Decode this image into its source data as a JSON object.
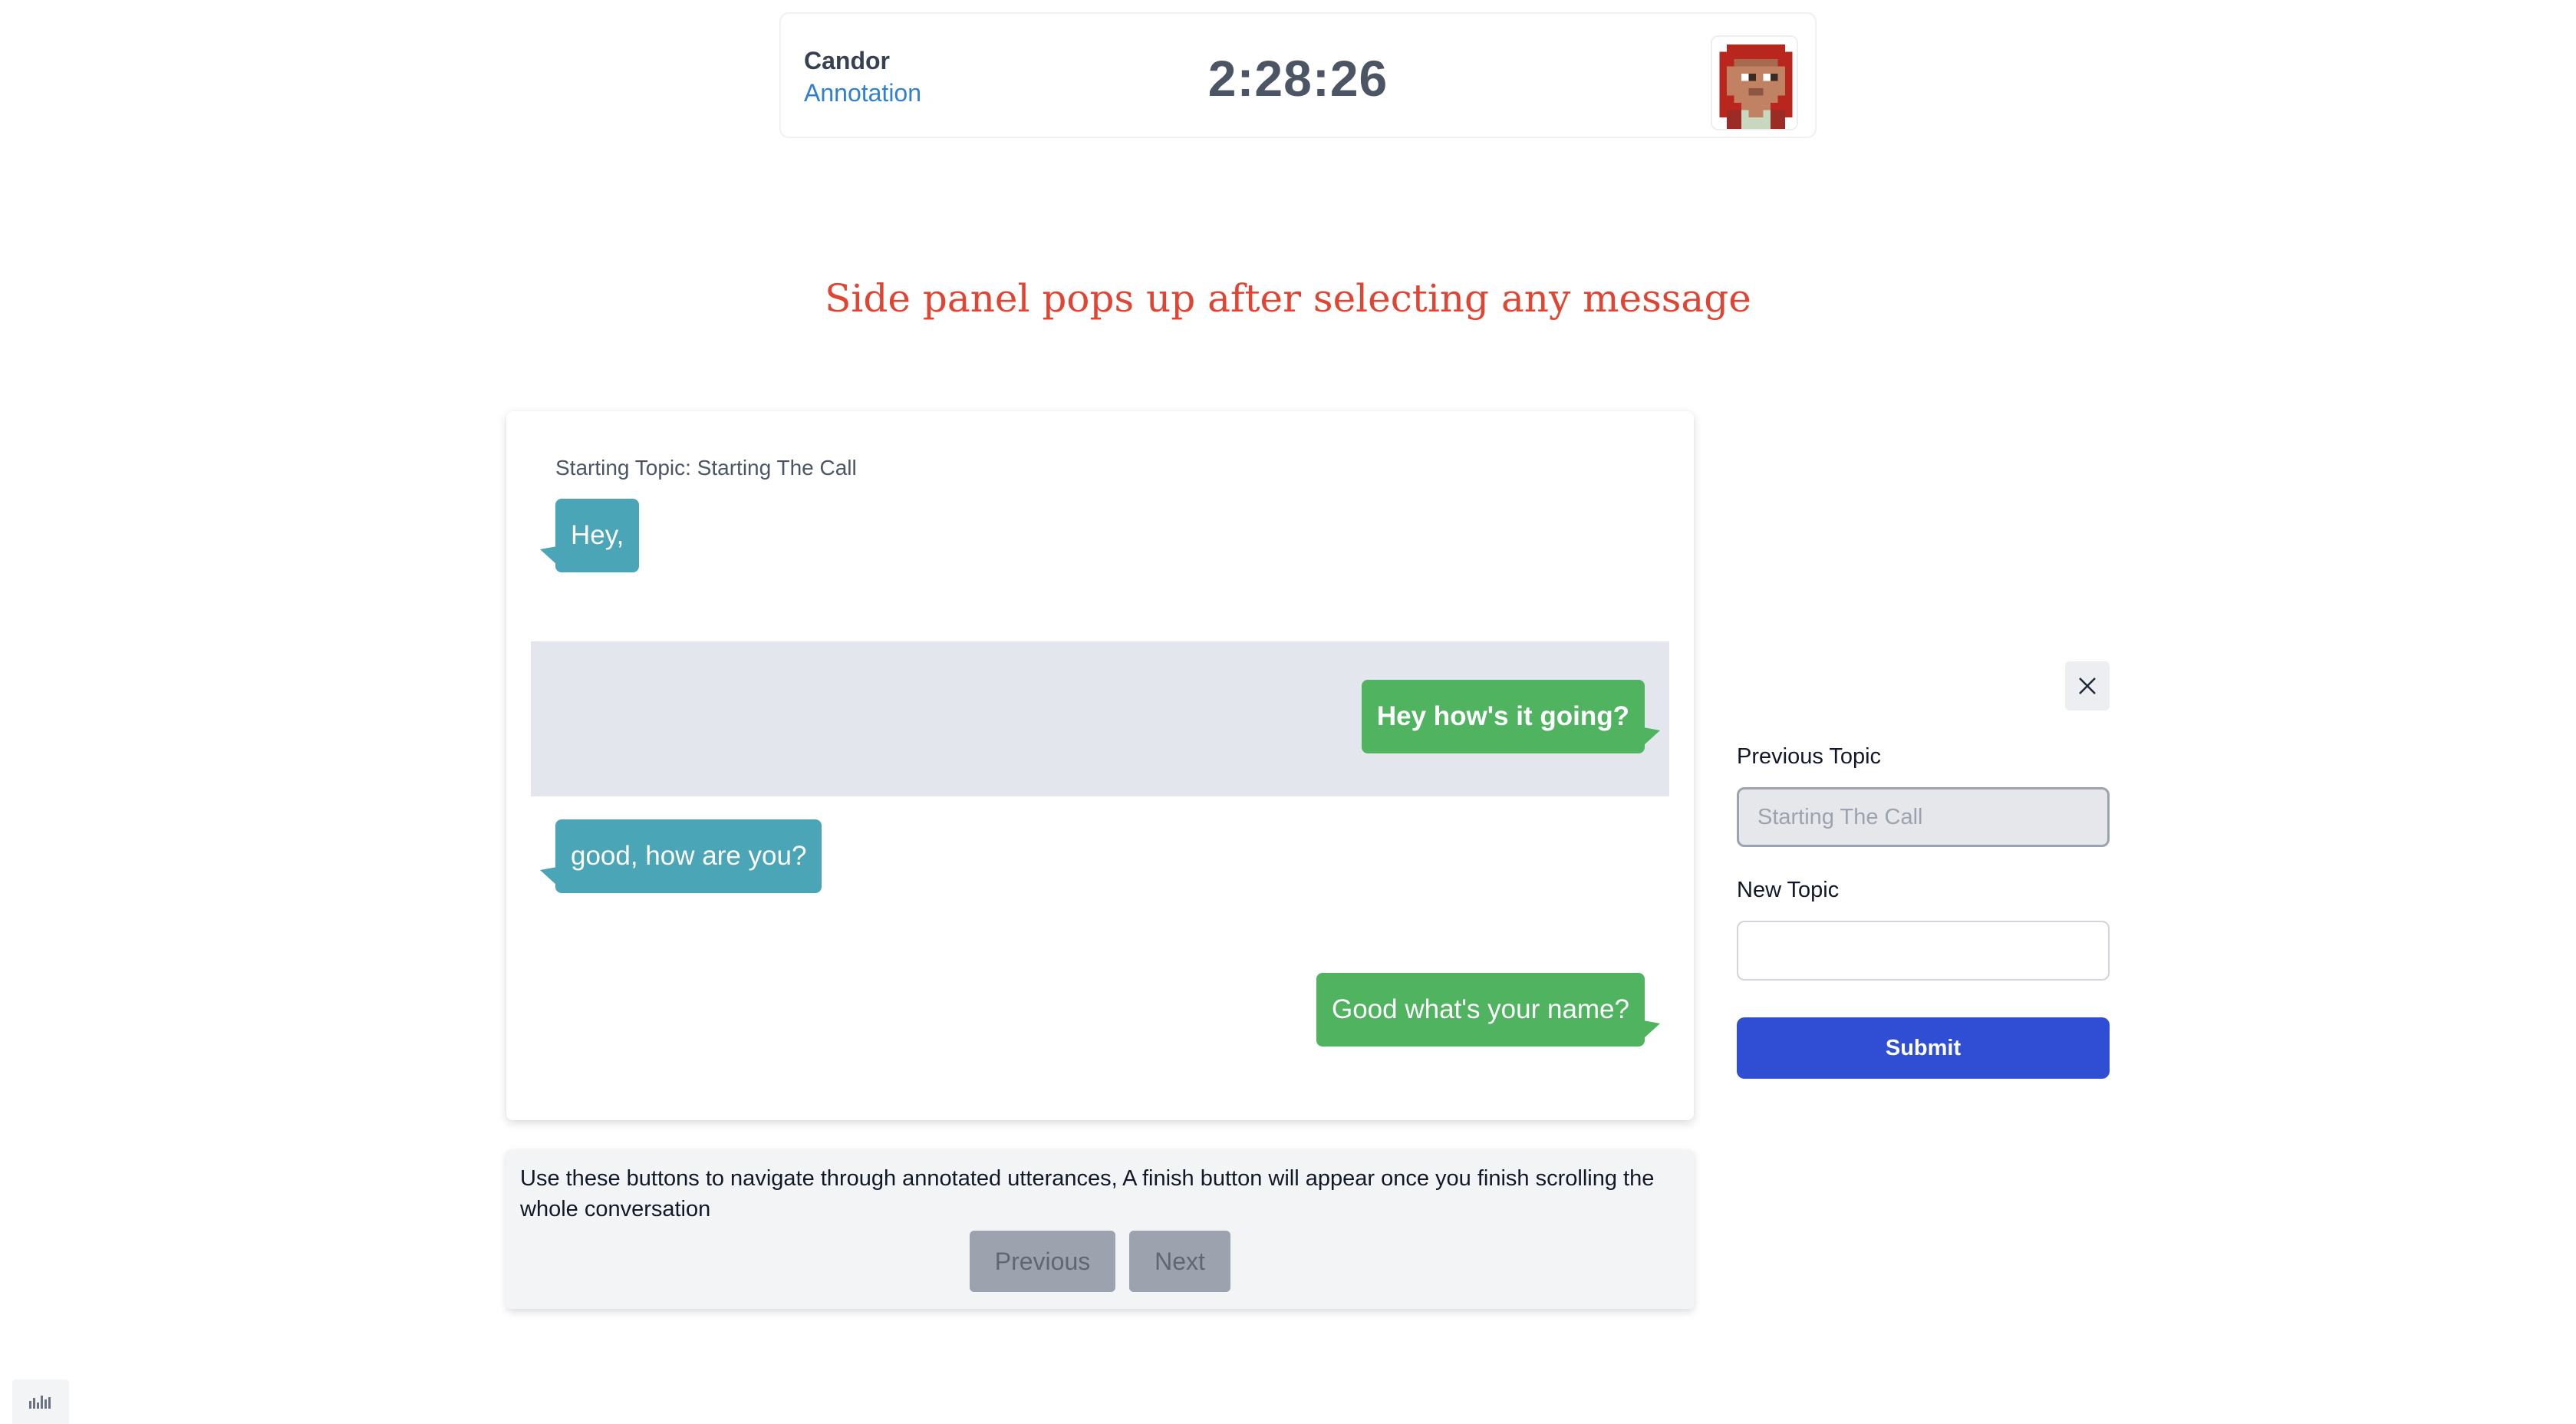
{
  "header": {
    "brand_name": "Candor",
    "brand_subtitle": "Annotation",
    "timer": "2:28:26",
    "avatar_icon": "pixel-avatar-icon"
  },
  "instruction_heading": "Side panel pops up after selecting any message",
  "chat": {
    "starting_topic": "Starting Topic: Starting The Call",
    "messages": [
      {
        "side": "left",
        "text": "Hey,",
        "selected": false
      },
      {
        "side": "right",
        "text": "Hey how's it going?",
        "selected": true
      },
      {
        "side": "left",
        "text": "good, how are you?",
        "selected": false
      },
      {
        "side": "right",
        "text": "Good what's your name?",
        "selected": false
      }
    ]
  },
  "navigation": {
    "help_text": "Use these buttons to navigate through annotated utterances, A finish button will appear once you finish scrolling the whole conversation",
    "previous_label": "Previous",
    "next_label": "Next"
  },
  "side_panel": {
    "close_icon": "close-icon",
    "previous_topic_label": "Previous Topic",
    "previous_topic_placeholder": "Starting The Call",
    "new_topic_label": "New Topic",
    "new_topic_value": "",
    "submit_label": "Submit"
  },
  "colors": {
    "brand_link": "#2f7fd2",
    "heading_red": "#e04433",
    "bubble_teal": "#4aa5b7",
    "bubble_green": "#4fb360",
    "selected_row": "#e3e7ed",
    "submit_blue": "#2f4ed4"
  },
  "corner_widget_icon": "audio-waveform-icon"
}
